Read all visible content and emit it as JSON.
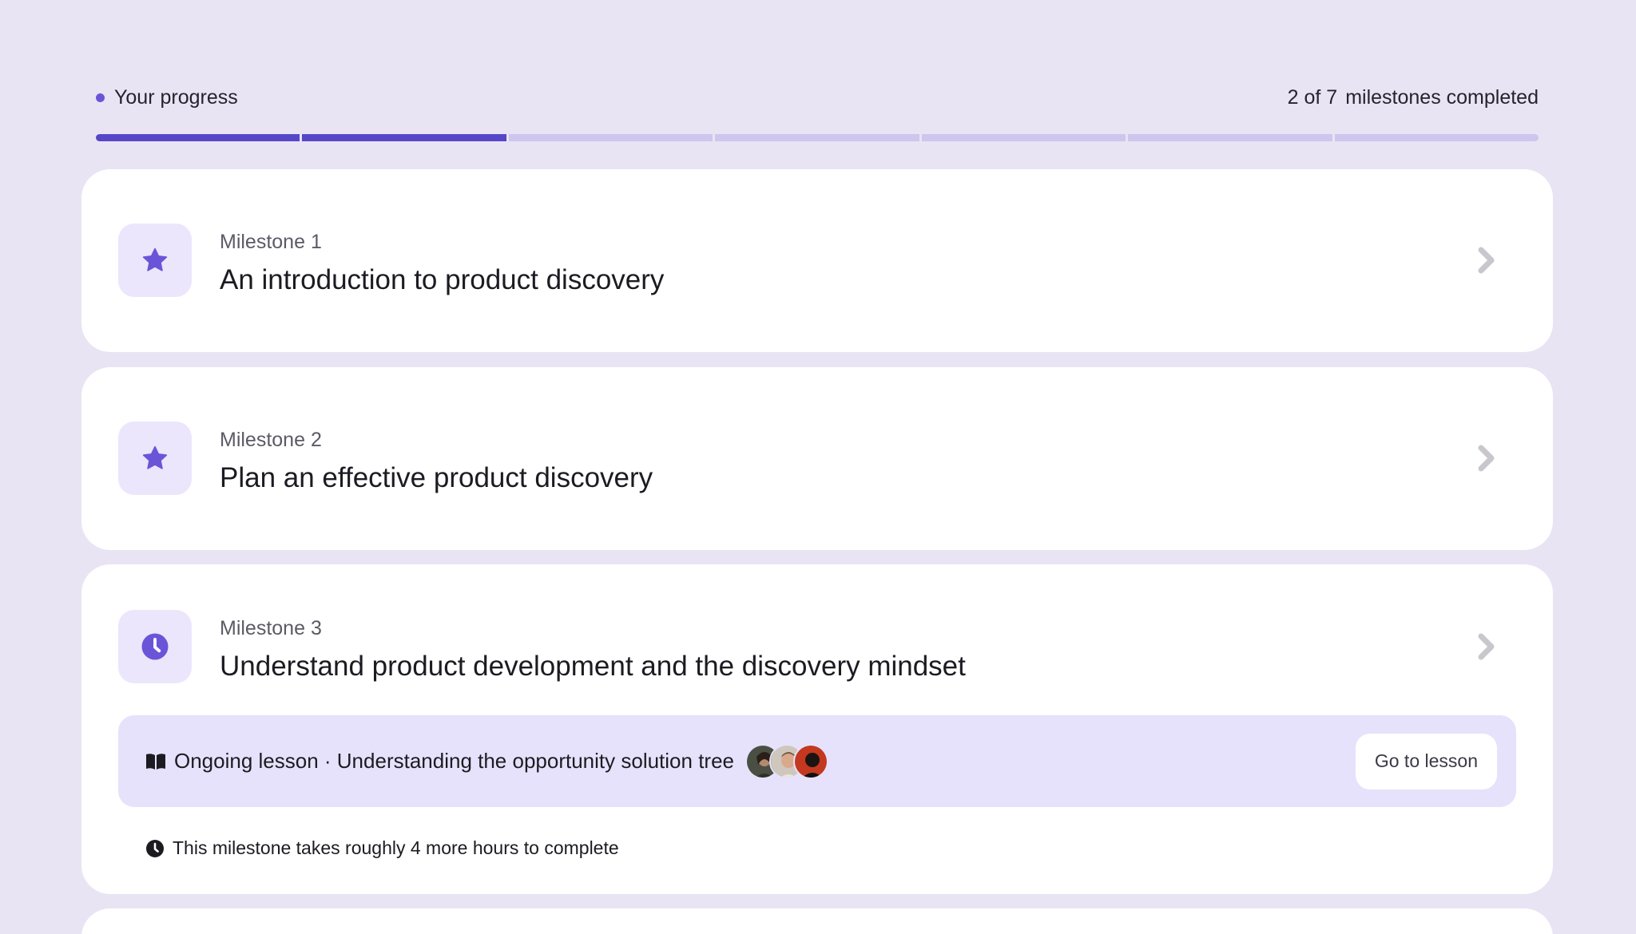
{
  "progress": {
    "title": "Your progress",
    "count_text": "2 of 7",
    "count_suffix": "milestones completed",
    "completed": 2,
    "total": 7,
    "accent": "#5547c8",
    "track": "#cdc6ee"
  },
  "milestones": [
    {
      "label": "Milestone 1",
      "title": "An introduction to product discovery",
      "icon": "star-icon",
      "status": "completed"
    },
    {
      "label": "Milestone 2",
      "title": "Plan an effective product discovery",
      "icon": "star-icon",
      "status": "completed"
    },
    {
      "label": "Milestone 3",
      "title": "Understand product development and the discovery mindset",
      "icon": "clock-icon",
      "status": "in-progress",
      "lesson": {
        "text": "Ongoing lesson · Understanding the opportunity solution tree",
        "icon": "book-icon",
        "button_label": "Go to lesson"
      },
      "time_note": {
        "icon": "clock-icon",
        "text": "This milestone takes roughly 4 more hours to complete"
      }
    }
  ],
  "colors": {
    "background": "#e9e4f3",
    "icon_tile": "#ebe6fb",
    "icon": "#6a55d8",
    "banner": "#e7e2fb",
    "chevron": "#c9c7cd"
  }
}
